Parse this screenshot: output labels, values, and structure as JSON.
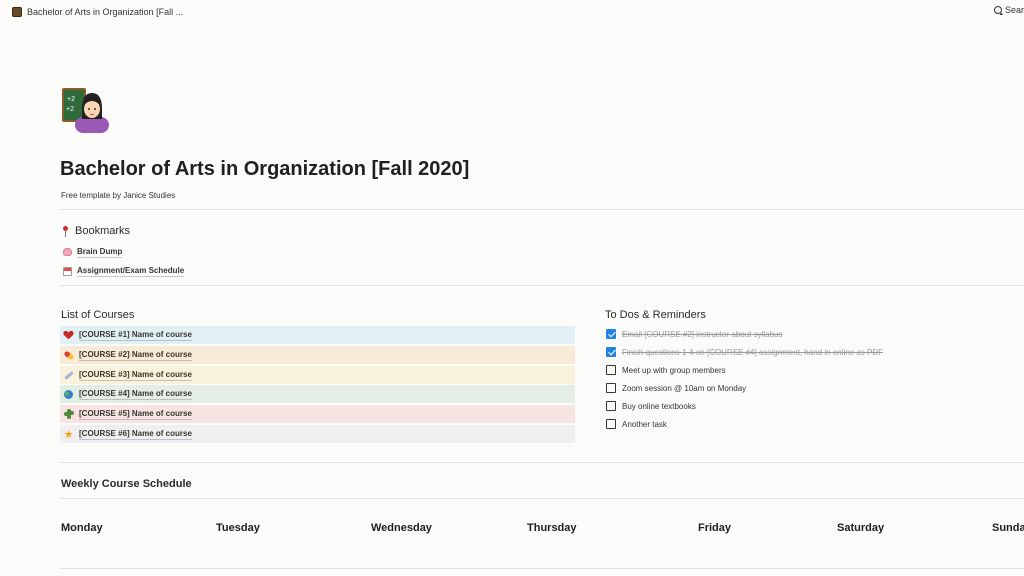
{
  "topbar": {
    "page_title": "Bachelor of Arts in Organization [Fall ...",
    "search_label": "Search"
  },
  "page": {
    "icon": "teacher-emoji-icon",
    "title": "Bachelor of Arts in Organization [Fall 2020]",
    "subtitle": "Free template by Janice Studies"
  },
  "bookmarks": {
    "title": "Bookmarks",
    "items": [
      {
        "label": "Brain Dump",
        "icon": "brain-icon"
      },
      {
        "label": "Assignment/Exam Schedule",
        "icon": "calendar-icon"
      }
    ]
  },
  "courses": {
    "title": "List of Courses",
    "items": [
      {
        "label": "[COURSE #1] Name of course",
        "icon": "heart-icon",
        "bg": "#e1f0f5"
      },
      {
        "label": "[COURSE #2] Name of course",
        "icon": "pill-icon",
        "bg": "#f7ead6"
      },
      {
        "label": "[COURSE #3] Name of course",
        "icon": "syringe-icon",
        "bg": "#f9f1d9"
      },
      {
        "label": "[COURSE #4] Name of course",
        "icon": "globe-icon",
        "bg": "#e3efe4"
      },
      {
        "label": "[COURSE #5] Name of course",
        "icon": "cactus-icon",
        "bg": "#f8e3e3"
      },
      {
        "label": "[COURSE #6] Name of course",
        "icon": "star-icon",
        "bg": "#efeff2"
      }
    ]
  },
  "todos": {
    "title": "To Dos & Reminders",
    "items": [
      {
        "label": "Email [COURSE #2] instructor about syllabus",
        "checked": true
      },
      {
        "label": "Finish questions 1-4 on [COURSE #4] assignment, hand in online as PDF",
        "checked": true
      },
      {
        "label": "Meet up with group members",
        "checked": false
      },
      {
        "label": "Zoom session @ 10am on Monday",
        "checked": false
      },
      {
        "label": "Buy online textbooks",
        "checked": false
      },
      {
        "label": "Another task",
        "checked": false
      }
    ]
  },
  "weekly": {
    "title": "Weekly Course Schedule",
    "days": [
      "Monday",
      "Tuesday",
      "Wednesday",
      "Thursday",
      "Friday",
      "Saturday",
      "Sunday"
    ]
  },
  "colors": {
    "accent": "#2383e2",
    "text": "#37352f",
    "background": "#fbfbfa"
  }
}
